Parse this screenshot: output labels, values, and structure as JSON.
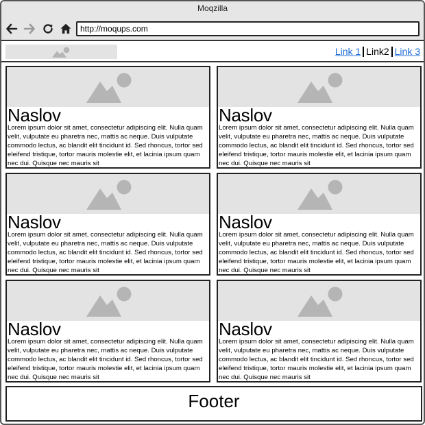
{
  "window": {
    "title": "Moqzilla"
  },
  "browser": {
    "url": "http://moqups.com",
    "icons": {
      "back": "arrow-left-icon",
      "forward": "arrow-right-icon",
      "reload": "reload-icon",
      "home": "home-icon"
    }
  },
  "header": {
    "logo_icon": "image-placeholder-icon",
    "links": [
      {
        "label": "Link 1",
        "active": false
      },
      {
        "label": "Link2",
        "active": true
      },
      {
        "label": "Link 3",
        "active": false
      }
    ]
  },
  "cards": [
    {
      "title": "Naslov",
      "text": "Lorem ipsum dolor sit amet, consectetur adipiscing elit. Nulla quam velit, vulputate eu pharetra nec, mattis ac neque. Duis vulputate commodo lectus, ac blandit elit tincidunt id. Sed rhoncus, tortor sed eleifend tristique, tortor mauris molestie elit, et lacinia ipsum quam nec dui. Quisque nec mauris sit"
    },
    {
      "title": "Naslov",
      "text": "Lorem ipsum dolor sit amet, consectetur adipiscing elit. Nulla quam velit, vulputate eu pharetra nec, mattis ac neque. Duis vulputate commodo lectus, ac blandit elit tincidunt id. Sed rhoncus, tortor sed eleifend tristique, tortor mauris molestie elit, et lacinia ipsum quam nec dui. Quisque nec mauris sit"
    },
    {
      "title": "Naslov",
      "text": "Lorem ipsum dolor sit amet, consectetur adipiscing elit. Nulla quam velit, vulputate eu pharetra nec, mattis ac neque. Duis vulputate commodo lectus, ac blandit elit tincidunt id. Sed rhoncus, tortor sed eleifend tristique, tortor mauris molestie elit, et lacinia ipsum quam nec dui. Quisque nec mauris sit"
    },
    {
      "title": "Naslov",
      "text": "Lorem ipsum dolor sit amet, consectetur adipiscing elit. Nulla quam velit, vulputate eu pharetra nec, mattis ac neque. Duis vulputate commodo lectus, ac blandit elit tincidunt id. Sed rhoncus, tortor sed eleifend tristique, tortor mauris molestie elit, et lacinia ipsum quam nec dui. Quisque nec mauris sit"
    },
    {
      "title": "Naslov",
      "text": "Lorem ipsum dolor sit amet, consectetur adipiscing elit. Nulla quam velit, vulputate eu pharetra nec, mattis ac neque. Duis vulputate commodo lectus, ac blandit elit tincidunt id. Sed rhoncus, tortor sed eleifend tristique, tortor mauris molestie elit, et lacinia ipsum quam nec dui. Quisque nec mauris sit"
    },
    {
      "title": "Naslov",
      "text": "Lorem ipsum dolor sit amet, consectetur adipiscing elit. Nulla quam velit, vulputate eu pharetra nec, mattis ac neque. Duis vulputate commodo lectus, ac blandit elit tincidunt id. Sed rhoncus, tortor sed eleifend tristique, tortor mauris molestie elit, et lacinia ipsum quam nec dui. Quisque nec mauris sit"
    }
  ],
  "card_image_icon": "image-placeholder-icon",
  "footer": {
    "label": "Footer"
  },
  "colors": {
    "chrome": "#e6e6e6",
    "placeholder": "#e3e3e3",
    "placeholder_icon": "#b5b5b5",
    "link": "#1f6fd6"
  }
}
